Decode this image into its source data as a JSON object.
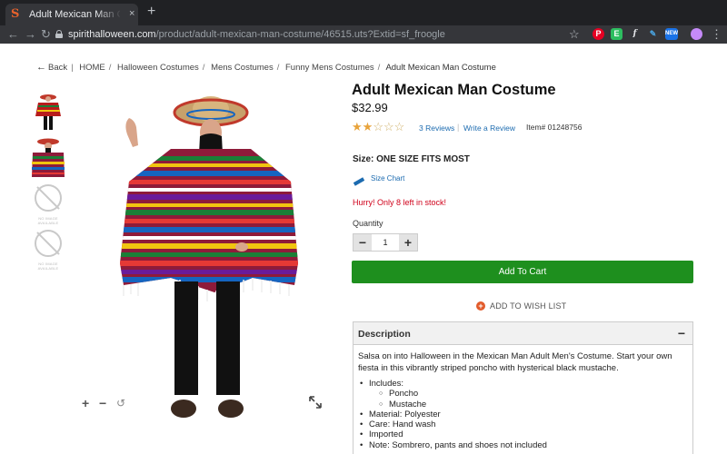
{
  "browser": {
    "tab_title": "Adult Mexican Man Costume -",
    "tab_close": "×",
    "new_tab": "+",
    "url_host": "spirithalloween.com",
    "url_path": "/product/adult-mexican-man-costume/46515.uts?Extid=sf_froogle",
    "extensions": [
      "pinterest-icon",
      "evernote-icon",
      "grammar-icon",
      "feather-icon",
      "task-icon",
      "profile-icon",
      "menu-icon"
    ]
  },
  "breadcrumb": {
    "back": "Back",
    "items": [
      "HOME",
      "Halloween Costumes",
      "Mens Costumes",
      "Funny Mens Costumes"
    ],
    "current": "Adult Mexican Man Costume"
  },
  "gallery": {
    "no_image_text": "NO IMAGE AVAILABLE",
    "zoom_in": "+",
    "zoom_out": "−",
    "reset": "↺"
  },
  "product": {
    "title": "Adult Mexican Man Costume",
    "price": "$32.99",
    "rating": 2,
    "rating_max": 5,
    "reviews": "3 Reviews",
    "review_sep": "|",
    "write_review": "Write a Review",
    "item_number": "Item# 01248756",
    "size_label": "Size:",
    "size_value": "ONE SIZE FITS MOST",
    "size_chart": "Size Chart",
    "stock_msg": "Hurry! Only 8 left in stock!",
    "quantity_label": "Quantity",
    "quantity": "1",
    "add_to_cart": "Add To Cart",
    "wish_list": "ADD TO WISH LIST"
  },
  "description": {
    "heading": "Description",
    "text": "Salsa on into Halloween in the Mexican Man Adult Men's Costume. Start your own fiesta in this vibrantly striped poncho with hysterical black mustache.",
    "includes_label": "Includes:",
    "includes": [
      "Poncho",
      "Mustache"
    ],
    "material": "Material: Polyester",
    "care": "Care: Hand wash",
    "imported": "Imported",
    "note": "Note: Sombrero, pants and shoes not included"
  }
}
